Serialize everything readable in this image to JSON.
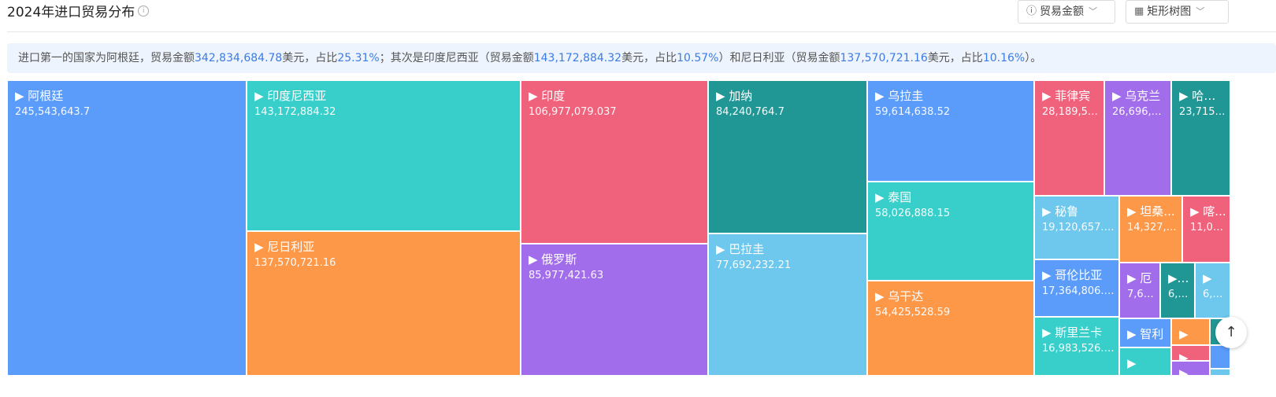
{
  "header": {
    "title": "2024年进口贸易分布",
    "info_icon": "info-icon",
    "metric_select": {
      "icon": "info-icon",
      "label": "贸易金额",
      "chevron": "chevron-down-icon"
    },
    "view_select": {
      "icon": "grid-icon",
      "label": "矩形树图",
      "chevron": "chevron-down-icon"
    }
  },
  "summary": {
    "t1": "进口第一的国家为阿根廷，贸易金额",
    "v1": "342,834,684.78",
    "t2": "美元，占比",
    "p1": "25.31%",
    "t3": "；其次是印度尼西亚（贸易金额",
    "v2": "143,172,884.32",
    "t4": "美元，占比",
    "p2": "10.57%",
    "t5": "）和尼日利亚（贸易金额",
    "v3": "137,570,721.16",
    "t6": "美元，占比",
    "p3": "10.16%",
    "t7": "）。"
  },
  "back_to_top": {
    "label": "↑",
    "icon": "arrow-up-icon"
  },
  "colors": {
    "blue": "#5b9bfa",
    "teal": "#38cfcb",
    "red": "#f0627c",
    "darkteal": "#219795",
    "orange": "#fe9849",
    "purple": "#a16dea",
    "lightblue": "#6ec7ec"
  },
  "chart_data": {
    "type": "treemap",
    "title": "2024年进口贸易分布",
    "items": [
      {
        "name": "阿根廷",
        "value": "245,543,643.7",
        "color": "blue"
      },
      {
        "name": "印度尼西亚",
        "value": "143,172,884.32",
        "color": "teal"
      },
      {
        "name": "尼日利亚",
        "value": "137,570,721.16",
        "color": "orange"
      },
      {
        "name": "印度",
        "value": "106,977,079.037",
        "color": "red"
      },
      {
        "name": "俄罗斯",
        "value": "85,977,421.63",
        "color": "purple"
      },
      {
        "name": "加纳",
        "value": "84,240,764.7",
        "color": "darkteal"
      },
      {
        "name": "巴拉圭",
        "value": "77,692,232.21",
        "color": "lightblue"
      },
      {
        "name": "乌拉圭",
        "value": "59,614,638.52",
        "color": "blue"
      },
      {
        "name": "泰国",
        "value": "58,026,888.15",
        "color": "teal"
      },
      {
        "name": "乌干达",
        "value": "54,425,528.59",
        "color": "orange"
      },
      {
        "name": "菲律宾",
        "value": "28,189,59...",
        "color": "red"
      },
      {
        "name": "乌克兰",
        "value": "26,696,93...",
        "color": "purple"
      },
      {
        "name": "哈萨...",
        "value": "23,715,...",
        "color": "darkteal"
      },
      {
        "name": "秘鲁",
        "value": "19,120,657.28",
        "color": "lightblue"
      },
      {
        "name": "哥伦比亚",
        "value": "17,364,806.02",
        "color": "blue"
      },
      {
        "name": "斯里兰卡",
        "value": "16,983,526.63",
        "color": "teal"
      },
      {
        "name": "坦桑...",
        "value": "14,327,3...",
        "color": "orange"
      },
      {
        "name": "喀...",
        "value": "11,09...",
        "color": "red"
      },
      {
        "name": "厄",
        "value": "7,60...",
        "color": "purple"
      },
      {
        "name": "土",
        "value": "6,7...",
        "color": "darkteal"
      },
      {
        "name": "",
        "value": "6,5...",
        "color": "lightblue"
      },
      {
        "name": "智利",
        "value": "",
        "color": "blue"
      },
      {
        "name": "",
        "value": "",
        "color": "teal"
      },
      {
        "name": "",
        "value": "",
        "color": "orange"
      },
      {
        "name": "",
        "value": "",
        "color": "red"
      },
      {
        "name": "",
        "value": "",
        "color": "purple"
      },
      {
        "name": "",
        "value": "",
        "color": "darkteal"
      },
      {
        "name": "",
        "value": "",
        "color": "blue"
      },
      {
        "name": "",
        "value": "",
        "color": "lightblue"
      }
    ]
  }
}
